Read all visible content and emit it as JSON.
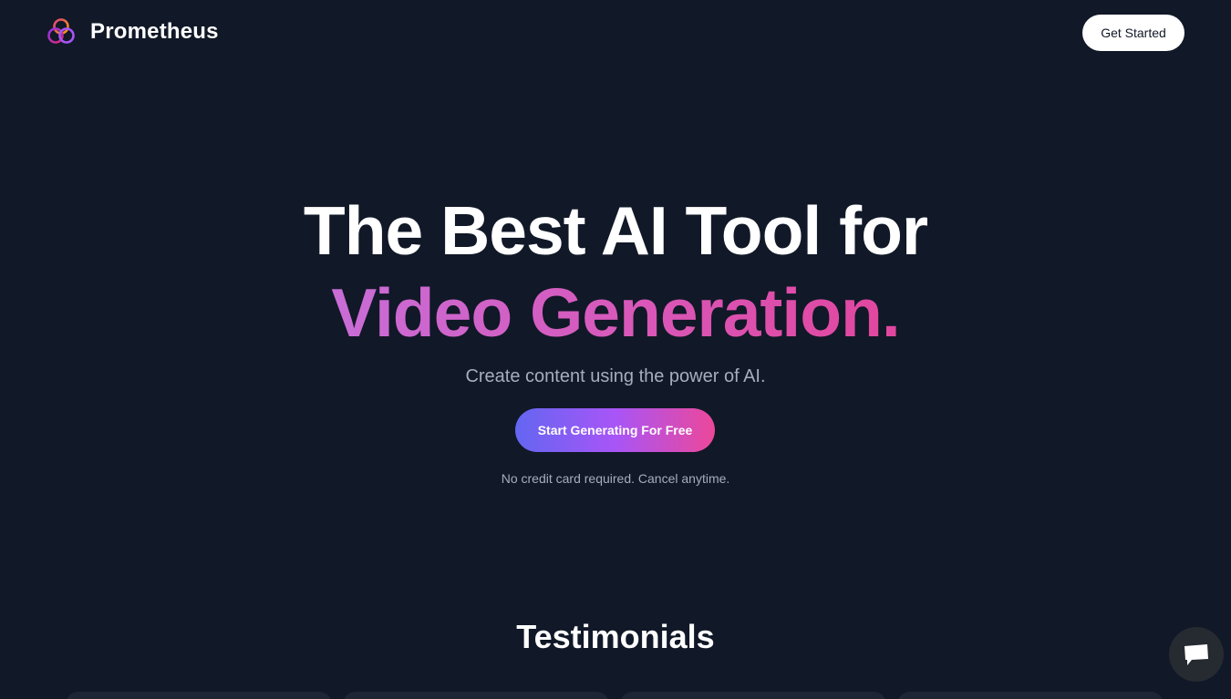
{
  "header": {
    "brand_name": "Prometheus",
    "get_started_label": "Get Started"
  },
  "hero": {
    "headline_line1": "The Best AI Tool for",
    "headline_line2": "Video Generation.",
    "subtitle": "Create content using the power of AI.",
    "cta_label": "Start Generating For Free",
    "note": "No credit card required. Cancel anytime."
  },
  "testimonials": {
    "title": "Testimonials"
  },
  "colors": {
    "background": "#111827",
    "gradient_start": "#c86dd7",
    "gradient_end": "#e1469e",
    "cta_gradient": [
      "#6366f1",
      "#a855f7",
      "#ec4899"
    ]
  },
  "icons": {
    "logo": "three-rings-logo-icon",
    "chat": "chat-bubble-icon"
  }
}
